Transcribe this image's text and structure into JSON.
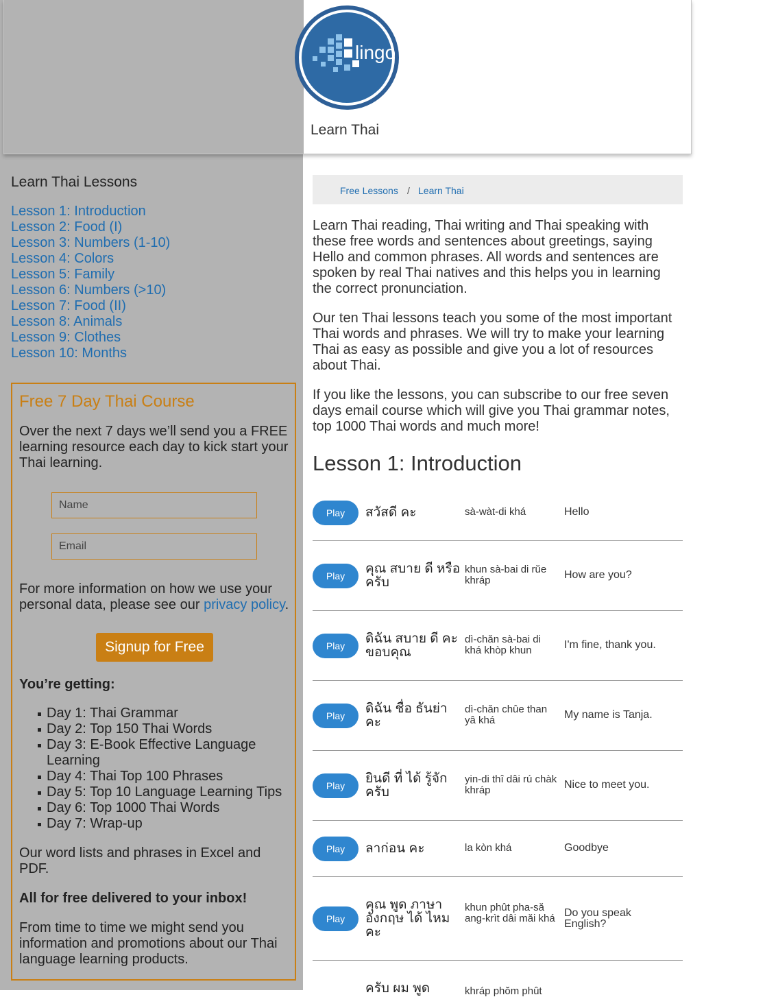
{
  "site": {
    "title": "Learn Thai",
    "logo_text": "lingo"
  },
  "sidebar": {
    "title": "Learn Thai Lessons",
    "lessons": [
      "Lesson 1: Introduction",
      "Lesson 2: Food (I)",
      "Lesson 3: Numbers (1-10)",
      "Lesson 4: Colors",
      "Lesson 5: Family",
      "Lesson 6: Numbers (>10)",
      "Lesson 7: Food (II)",
      "Lesson 8: Animals",
      "Lesson 9: Clothes",
      "Lesson 10: Months"
    ]
  },
  "course": {
    "title": "Free 7 Day Thai Course",
    "intro": "Over the next 7 days we’ll send you a FREE learning resource each day to kick start your Thai learning.",
    "name_placeholder": "Name",
    "email_placeholder": "Email",
    "privacy_text": "For more information on how we use your personal data, please see our ",
    "privacy_link": "privacy policy",
    "privacy_end": ".",
    "signup_label": "Signup for Free",
    "getting_title": "You’re getting:",
    "days": [
      "Day 1: Thai Grammar",
      "Day 2: Top 150 Thai Words",
      "Day 3: E-Book Effective Language Learning",
      "Day 4: Thai Top 100 Phrases",
      "Day 5: Top 10 Language Learning Tips",
      "Day 6: Top 1000 Thai Words",
      "Day 7: Wrap-up"
    ],
    "excel_text": "Our word lists and phrases in Excel and PDF.",
    "free_text": "All for free delivered to your inbox!",
    "promo_text": "From time to time we might send you information and promotions about our Thai language learning products."
  },
  "breadcrumb": {
    "item1": "Free Lessons",
    "separator": "/",
    "item2": "Learn Thai"
  },
  "main": {
    "p1": "Learn Thai reading, Thai writing and Thai speaking with these free words and sentences about greetings, saying Hello and common phrases. All words and sentences are spoken by real Thai natives and this helps you in learning the correct pronunciation.",
    "p2": "Our ten Thai lessons teach you some of the most important Thai words and phrases. We will try to make your learning Thai as easy as possible and give you a lot of resources about Thai.",
    "p3": "If you like the lessons, you can subscribe to our free seven days email course which will give you Thai grammar notes, top 1000 Thai words and much more!",
    "lesson_title": "Lesson 1: Introduction",
    "play_label": "Play",
    "phrases": [
      {
        "thai": "สวัสดี คะ",
        "translit": "sà-wàt-di khá",
        "english": "Hello"
      },
      {
        "thai": "คุณ สบาย ดี หรือ ครับ",
        "translit": "khun sà-bai di rŭe khráp",
        "english": "How are you?"
      },
      {
        "thai": "ดิฉัน สบาย ดี คะ ขอบคุณ",
        "translit": "dì-chăn sà-bai di khá khòp khun",
        "english": "I'm fine, thank you."
      },
      {
        "thai": "ดิฉัน ชื่อ ธันย่า คะ",
        "translit": "dì-chăn chûe than yâ khá",
        "english": "My name is Tanja."
      },
      {
        "thai": "ยินดี ที่ ได้ รู้จัก ครับ",
        "translit": "yin-di thî dâi rú chàk khráp",
        "english": "Nice to meet you."
      },
      {
        "thai": "ลาก่อน คะ",
        "translit": "la kòn khá",
        "english": "Goodbye"
      },
      {
        "thai": "คุณ พูด ภาษา อังกฤษ ได้ ไหม คะ",
        "translit": "khun phût pha-să ang-krìt dâi măi khá",
        "english": "Do you speak English?"
      },
      {
        "thai": "ครับ ผม พูด",
        "translit": "khráp phŏm phût",
        "english": ""
      }
    ]
  }
}
